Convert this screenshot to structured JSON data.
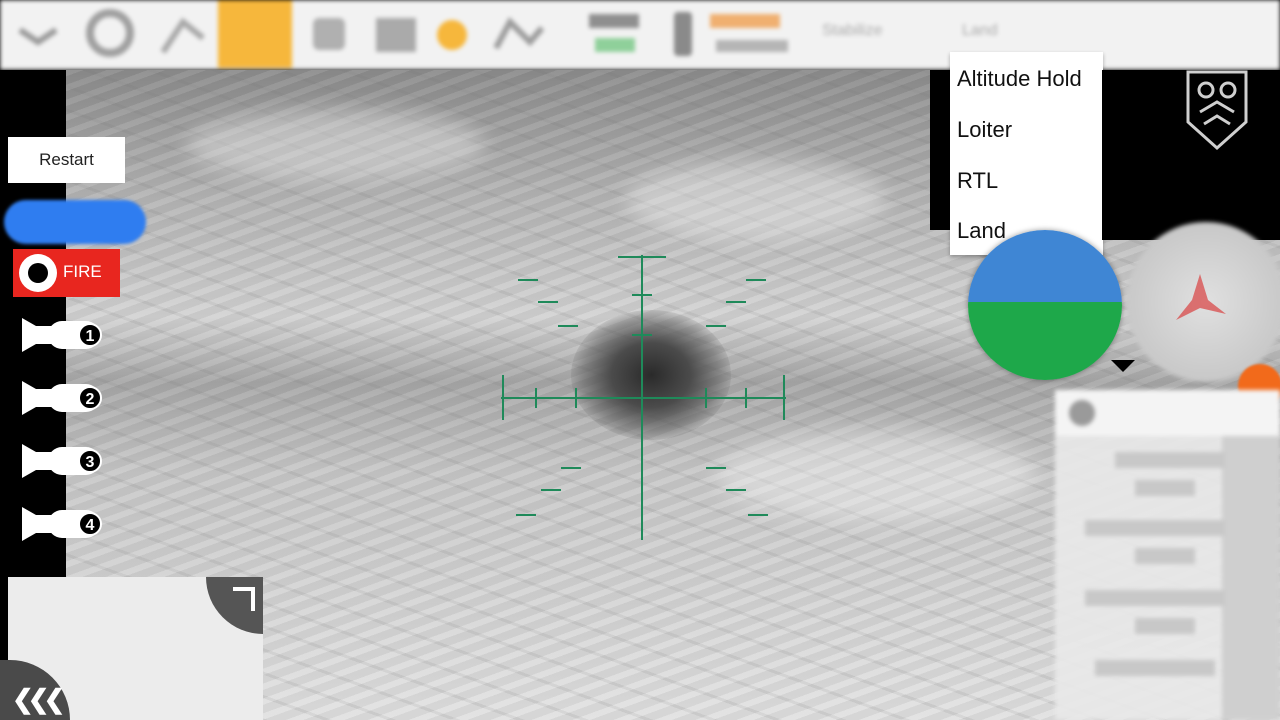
{
  "toolbar": {
    "highlight_color": "#f6b73c",
    "icons": [
      "menu-icon",
      "settings-gear-icon",
      "plan-icon",
      "camera-icon",
      "map-icon",
      "vehicle-icon",
      "status-dot-icon",
      "signal-icon",
      "gps-icon",
      "battery-icon"
    ],
    "flight_mode_label": "Stabilize",
    "land_label": "Land"
  },
  "controls": {
    "restart_label": "Restart",
    "fire_label": "FIRE",
    "fire_color": "#e8261f",
    "arm_color": "#2f7df0",
    "bombs": [
      "1",
      "2",
      "3",
      "4"
    ]
  },
  "mode_menu": {
    "items": [
      "Altitude Hold",
      "Loiter",
      "RTL",
      "Land"
    ]
  },
  "hud": {
    "reticle_color": "#1f8a5a",
    "attitude_sky_color": "#3f86d4",
    "attitude_ground_color": "#1ea84a"
  }
}
